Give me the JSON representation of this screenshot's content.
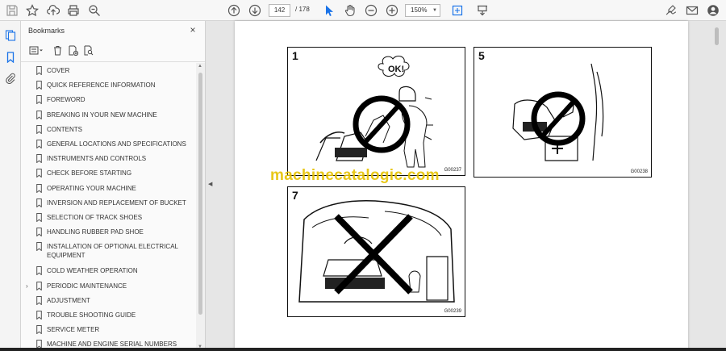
{
  "toolbar": {
    "page_current": "142",
    "page_total": "/ 178",
    "zoom": "150%"
  },
  "bookmarks": {
    "title": "Bookmarks",
    "close": "×",
    "items": [
      {
        "label": "COVER"
      },
      {
        "label": "QUICK REFERENCE INFORMATION"
      },
      {
        "label": "FOREWORD"
      },
      {
        "label": "BREAKING IN YOUR NEW MACHINE"
      },
      {
        "label": "CONTENTS"
      },
      {
        "label": "GENERAL LOCATIONS AND SPECIFICATIONS"
      },
      {
        "label": "INSTRUMENTS AND CONTROLS"
      },
      {
        "label": "CHECK BEFORE STARTING"
      },
      {
        "label": "OPERATING YOUR MACHINE"
      },
      {
        "label": "INVERSION AND REPLACEMENT OF BUCKET"
      },
      {
        "label": "SELECTION OF TRACK SHOES"
      },
      {
        "label": "HANDLING RUBBER PAD SHOE"
      },
      {
        "label": "INSTALLATION OF OPTIONAL ELECTRICAL EQUIPMENT"
      },
      {
        "label": "COLD WEATHER OPERATION"
      },
      {
        "label": "PERIODIC MAINTENANCE",
        "expandable": true
      },
      {
        "label": "ADJUSTMENT"
      },
      {
        "label": "TROUBLE SHOOTING GUIDE"
      },
      {
        "label": "SERVICE METER"
      },
      {
        "label": "MACHINE AND ENGINE SERIAL NUMBERS"
      }
    ]
  },
  "document": {
    "watermark": "machinecatalogic.com",
    "panels": [
      {
        "number": "1",
        "code": "G00237",
        "caption": "OK!"
      },
      {
        "number": "5",
        "code": "G00238"
      },
      {
        "number": "7",
        "code": "G00239"
      }
    ]
  }
}
